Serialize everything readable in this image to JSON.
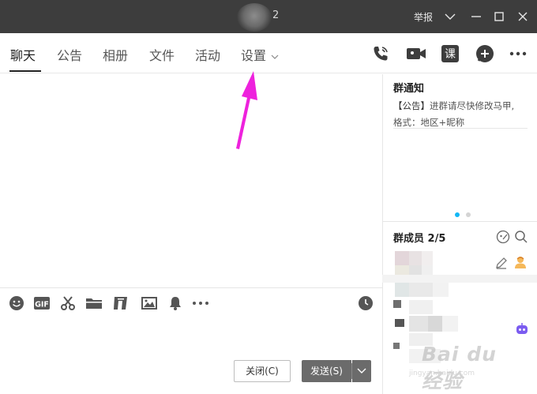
{
  "window": {
    "title": "2",
    "report_label": "举报",
    "controls": [
      "chevron-down-icon",
      "minimize-icon",
      "maximize-icon",
      "close-icon"
    ]
  },
  "tabs": [
    {
      "label": "聊天",
      "active": true
    },
    {
      "label": "公告",
      "active": false
    },
    {
      "label": "相册",
      "active": false
    },
    {
      "label": "文件",
      "active": false
    },
    {
      "label": "活动",
      "active": false
    },
    {
      "label": "设置",
      "active": false,
      "has_dropdown": true
    }
  ],
  "toolbar_icons": [
    "phone-call-icon",
    "video-call-icon",
    "course-icon",
    "add-app-icon",
    "more-icon"
  ],
  "toolbar_course_glyph": "课",
  "input_toolbar_icons": [
    "emoji-icon",
    "gif-icon",
    "scissors-icon",
    "folder-icon",
    "music-icon",
    "image-icon",
    "bell-icon",
    "more-icon",
    "history-clock-icon"
  ],
  "input_toolbar_gif_label": "GIF",
  "buttons": {
    "close": "关闭(C)",
    "send": "发送(S)"
  },
  "notice": {
    "title": "群通知",
    "tag": "【公告】",
    "line1": "进群请尽快修改马甲,",
    "line2": "格式：地区+昵称"
  },
  "carousel": {
    "dots": 2,
    "active_index": 0
  },
  "members": {
    "title": "群成员",
    "count": "2/5"
  },
  "watermark": {
    "text": "Bai du 经验",
    "sub": "jingyan.baidu.com"
  },
  "colors": {
    "titlebar": "#3d3d3d",
    "accent_blue": "#12b7f5",
    "annotation_arrow": "#ee22dd",
    "send_button": "#6b6b6b",
    "robot_icon": "#7b5cf0"
  }
}
